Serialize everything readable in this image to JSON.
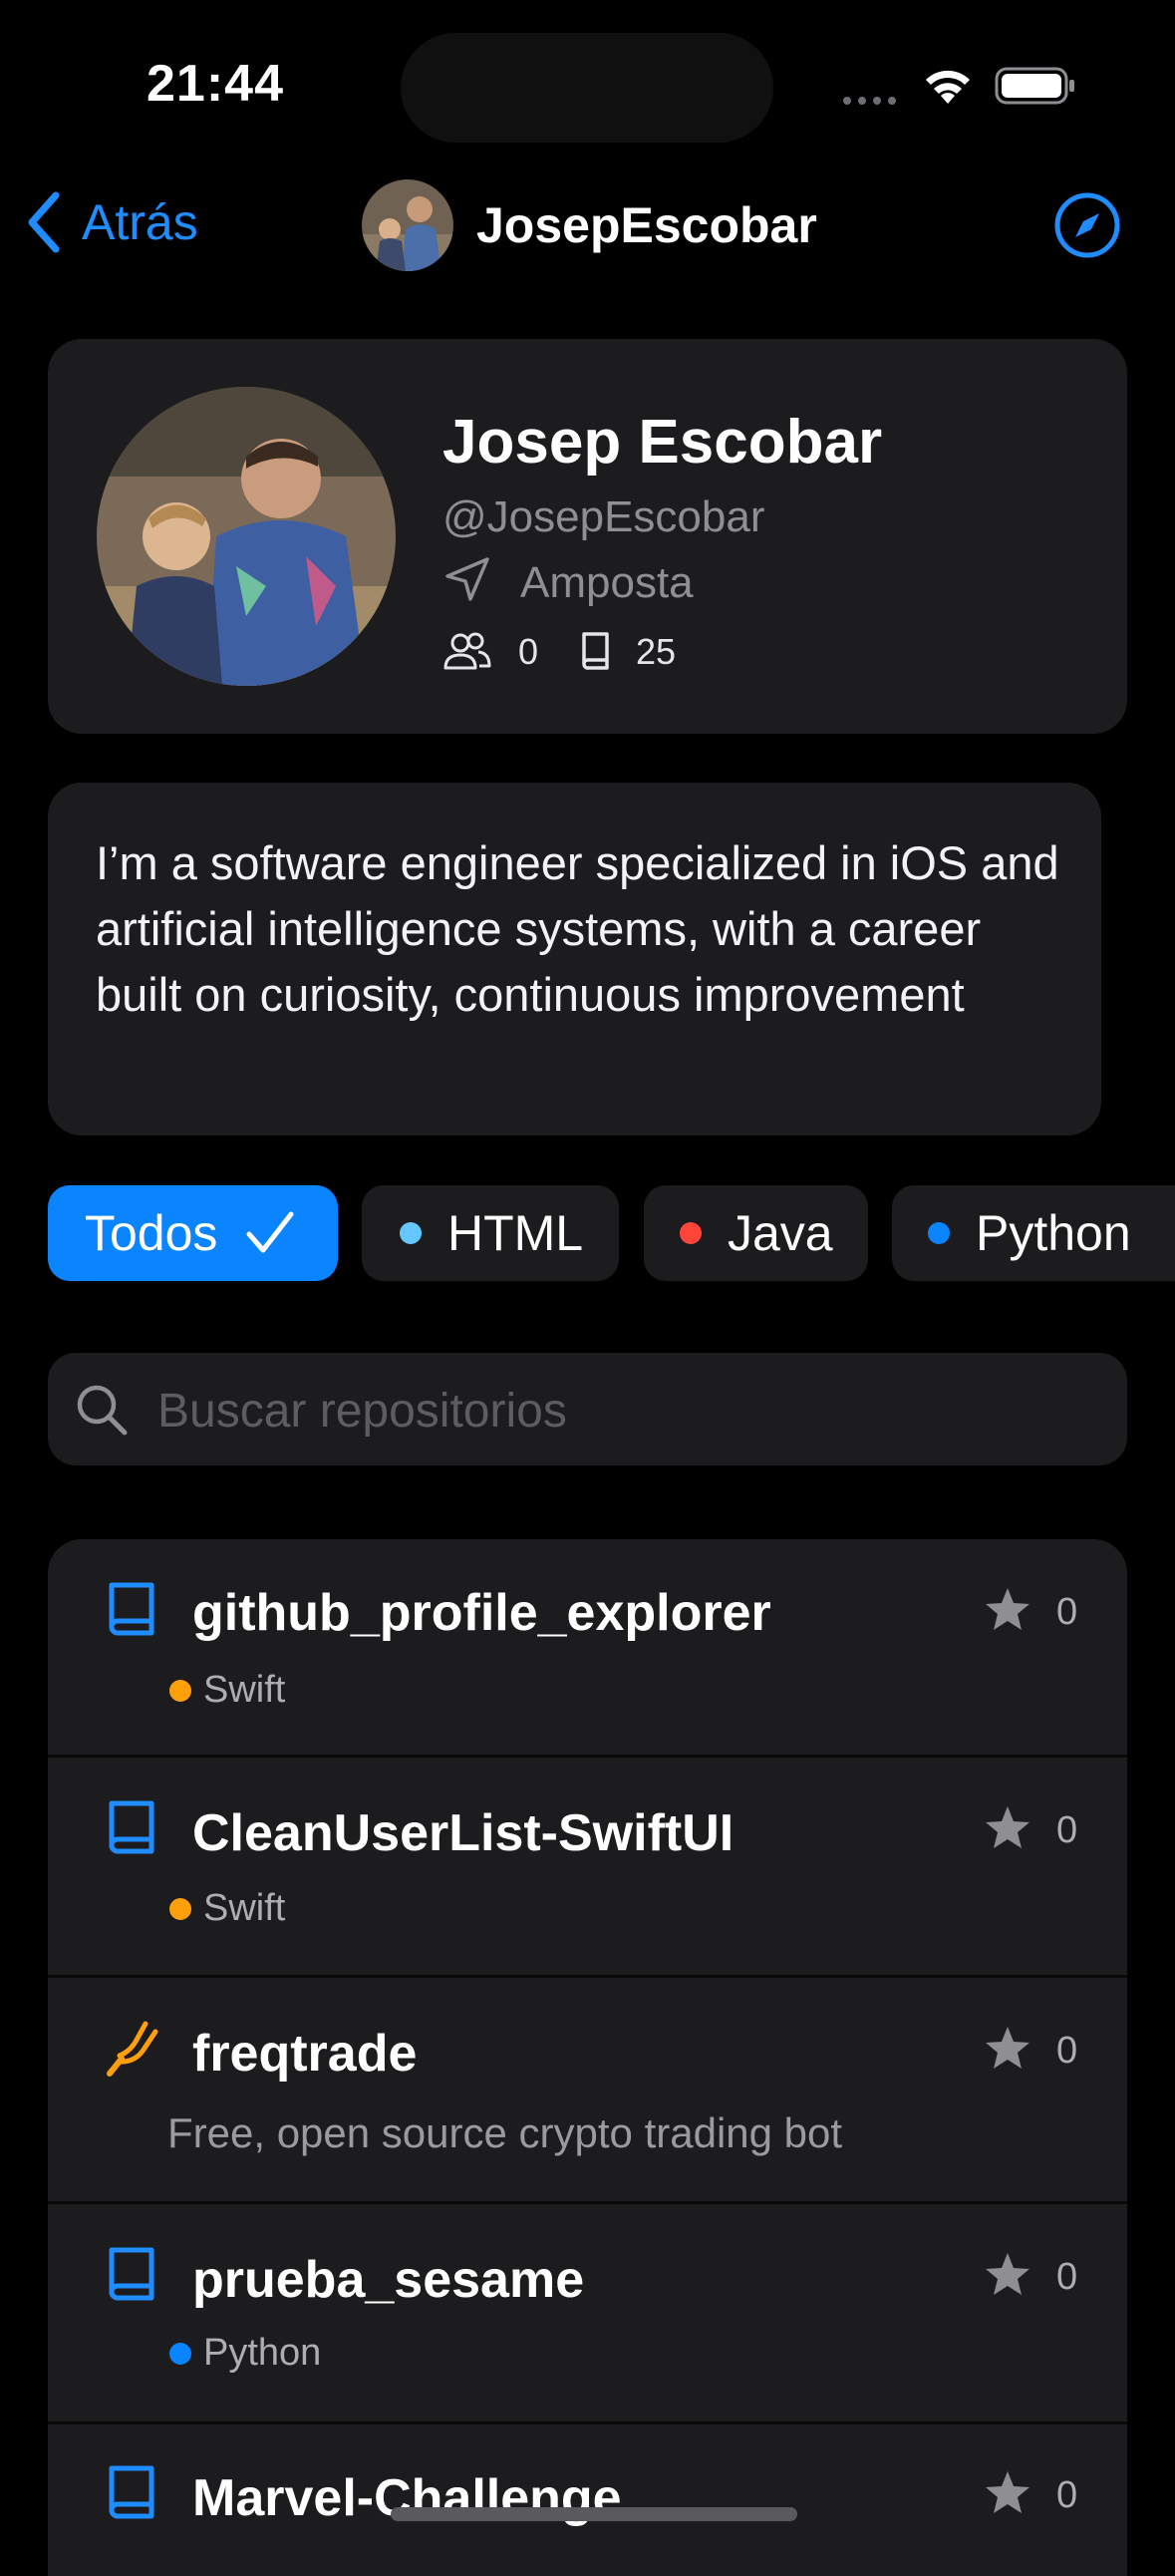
{
  "status_bar": {
    "time": "21:44"
  },
  "nav": {
    "back_label": "Atrás",
    "title": "JosepEscobar"
  },
  "profile": {
    "name": "Josep Escobar",
    "username": "@JosepEscobar",
    "location": "Amposta",
    "followers": "0",
    "repos": "25"
  },
  "bio": "I’m a software engineer specialized in iOS and artificial intelligence systems, with a career built on curiosity, continuous improvement",
  "filters": [
    {
      "label": "Todos",
      "selected": true
    },
    {
      "label": "HTML",
      "color": "#64c8ff"
    },
    {
      "label": "Java",
      "color": "#ff453a"
    },
    {
      "label": "Python",
      "color": "#0a84ff"
    }
  ],
  "search": {
    "placeholder": "Buscar repositorios"
  },
  "repositories": [
    {
      "name": "github_profile_explorer",
      "language": "Swift",
      "language_color": "#ff9f0a",
      "stars": "0",
      "icon": "book-icon"
    },
    {
      "name": "CleanUserList-SwiftUI",
      "language": "Swift",
      "language_color": "#ff9f0a",
      "stars": "0",
      "icon": "book-icon"
    },
    {
      "name": "freqtrade",
      "description": "Free, open source crypto trading bot",
      "stars": "0",
      "icon": "fork-icon"
    },
    {
      "name": "prueba_sesame",
      "language": "Python",
      "language_color": "#0a84ff",
      "stars": "0",
      "icon": "book-icon"
    },
    {
      "name": "Marvel-Challenge",
      "stars": "0",
      "icon": "book-icon"
    }
  ],
  "colors": {
    "accent": "#0a84ff",
    "background": "#000000",
    "card": "#1c1c1e"
  }
}
